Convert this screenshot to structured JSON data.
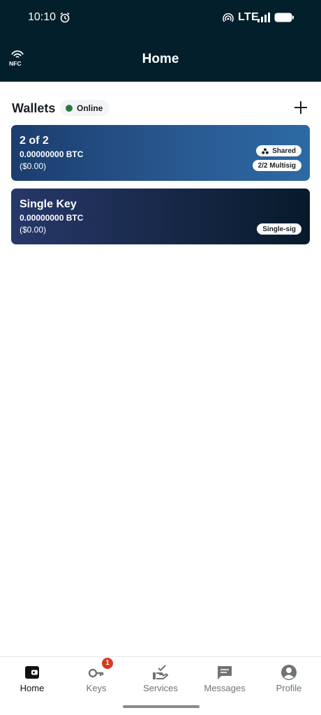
{
  "status_bar": {
    "time": "10:10",
    "network": "LTE",
    "icons": [
      "alarm-icon",
      "hotspot-icon",
      "signal-icon",
      "battery-icon"
    ]
  },
  "header": {
    "title": "Home",
    "nfc_label": "NFC",
    "background": "#031f2b"
  },
  "wallets": {
    "title": "Wallets",
    "status": "Online",
    "status_color": "#2a7a3e",
    "cards": [
      {
        "name": "2 of 2",
        "btc": "0.00000000 BTC",
        "fiat": "($0.00)",
        "chips": [
          "Shared",
          "2/2 Multisig"
        ]
      },
      {
        "name": "Single Key",
        "btc": "0.00000000 BTC",
        "fiat": "($0.00)",
        "chips": [
          "Single-sig"
        ]
      }
    ]
  },
  "bottom_nav": {
    "items": [
      {
        "label": "Home",
        "icon": "wallet-icon",
        "active": true
      },
      {
        "label": "Keys",
        "icon": "key-icon",
        "badge": "1"
      },
      {
        "label": "Services",
        "icon": "services-hand-icon"
      },
      {
        "label": "Messages",
        "icon": "message-icon"
      },
      {
        "label": "Profile",
        "icon": "profile-icon"
      }
    ]
  }
}
